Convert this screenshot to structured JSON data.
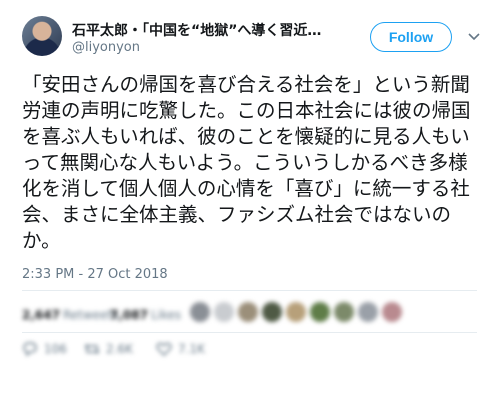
{
  "tweet": {
    "author_name": "石平太郎・「中国を“地獄”へ導く習近…",
    "author_handle": "@liyonyon",
    "follow_label": "Follow",
    "text": "「安田さんの帰国を喜び合える社会を」という新聞労連の声明に吃驚した。この日本社会には彼の帰国を喜ぶ人もいれば、彼のことを懐疑的に見る人もいって無関心な人もいよう。こういうしかるべき多様化を消して個人個人の心情を「喜び」に統一する社会、まさに全体主義、ファシズム社会ではないのか。",
    "timestamp": "2:33 PM - 27 Oct 2018"
  },
  "stats": {
    "retweets_count": "2,647",
    "retweets_label": "Retweets",
    "likes_count": "7,087",
    "likes_label": "Likes"
  },
  "actions": {
    "reply_count": "106",
    "retweet_count": "2.6K",
    "like_count": "7.1K"
  },
  "colors": {
    "accent": "#1da1f2",
    "text": "#14171a",
    "secondary": "#657786",
    "divider": "#e6ecf0"
  },
  "icons": {
    "chevron": "chevron-down-icon",
    "reply": "reply-icon",
    "retweet": "retweet-icon",
    "like": "heart-icon"
  }
}
